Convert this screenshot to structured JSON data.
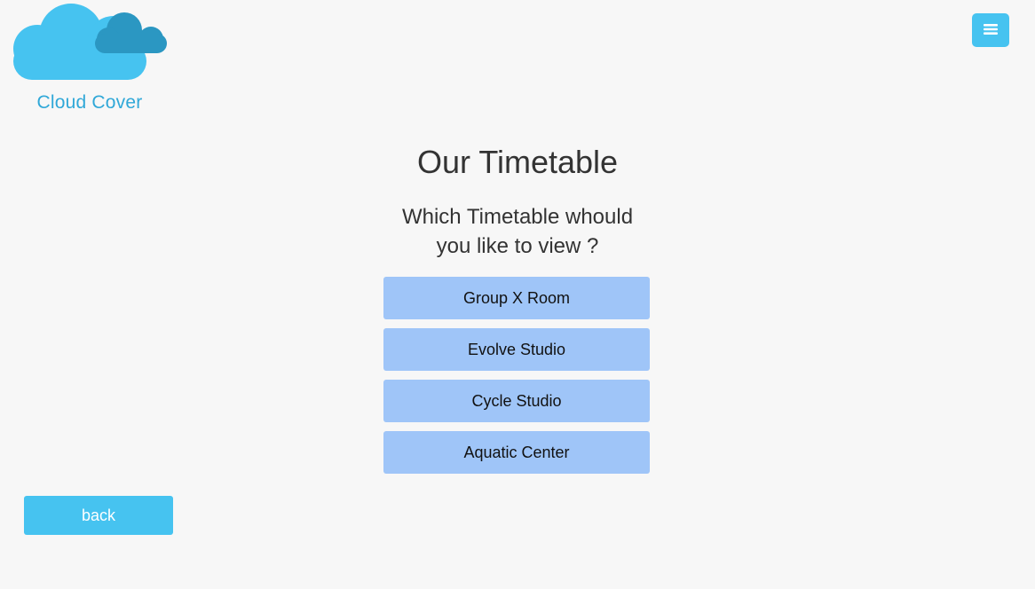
{
  "brand": {
    "name": "Cloud Cover",
    "logo_icon": "cloud-logo-icon",
    "colors": {
      "cloud_light": "#46c3f0",
      "cloud_dark": "#2b97c2",
      "text": "#30a8d8"
    }
  },
  "header": {
    "menu_icon": "hamburger-menu-icon",
    "menu_color": "#46c3f0"
  },
  "main": {
    "title": "Our Timetable",
    "question_line1": "Which Timetable whould",
    "question_line2": "you like to view ?",
    "options": [
      {
        "label": "Group X Room"
      },
      {
        "label": "Evolve Studio"
      },
      {
        "label": "Cycle Studio"
      },
      {
        "label": "Aquatic Center"
      }
    ],
    "option_color": "#9fc5f8"
  },
  "footer": {
    "back_label": "back",
    "back_color": "#46c3f0"
  }
}
